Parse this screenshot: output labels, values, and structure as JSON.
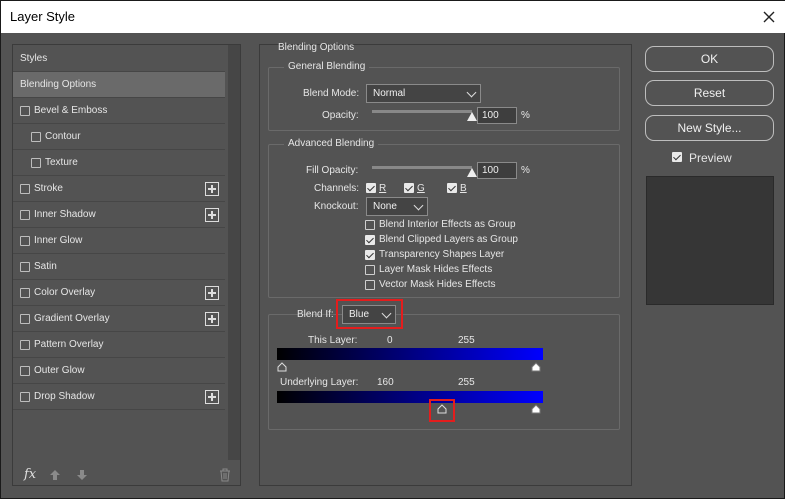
{
  "window": {
    "title": "Layer Style"
  },
  "left": {
    "items": [
      {
        "label": "Styles",
        "checkbox": false,
        "indent": 0,
        "plus": false,
        "selected": false
      },
      {
        "label": "Blending Options",
        "checkbox": false,
        "indent": 0,
        "plus": false,
        "selected": true
      },
      {
        "label": "Bevel & Emboss",
        "checkbox": true,
        "indent": 0,
        "plus": false,
        "selected": false
      },
      {
        "label": "Contour",
        "checkbox": true,
        "indent": 1,
        "plus": false,
        "selected": false
      },
      {
        "label": "Texture",
        "checkbox": true,
        "indent": 1,
        "plus": false,
        "selected": false
      },
      {
        "label": "Stroke",
        "checkbox": true,
        "indent": 0,
        "plus": true,
        "selected": false
      },
      {
        "label": "Inner Shadow",
        "checkbox": true,
        "indent": 0,
        "plus": true,
        "selected": false
      },
      {
        "label": "Inner Glow",
        "checkbox": true,
        "indent": 0,
        "plus": false,
        "selected": false
      },
      {
        "label": "Satin",
        "checkbox": true,
        "indent": 0,
        "plus": false,
        "selected": false
      },
      {
        "label": "Color Overlay",
        "checkbox": true,
        "indent": 0,
        "plus": true,
        "selected": false
      },
      {
        "label": "Gradient Overlay",
        "checkbox": true,
        "indent": 0,
        "plus": true,
        "selected": false
      },
      {
        "label": "Pattern Overlay",
        "checkbox": true,
        "indent": 0,
        "plus": false,
        "selected": false
      },
      {
        "label": "Outer Glow",
        "checkbox": true,
        "indent": 0,
        "plus": false,
        "selected": false
      },
      {
        "label": "Drop Shadow",
        "checkbox": true,
        "indent": 0,
        "plus": true,
        "selected": false
      }
    ],
    "fx_label": "fx"
  },
  "blending": {
    "section_title": "Blending Options",
    "general": {
      "title": "General Blending",
      "mode_label": "Blend Mode:",
      "mode_value": "Normal",
      "opacity_label": "Opacity:",
      "opacity_value": "100",
      "opacity_unit": "%",
      "opacity_level": 1.0
    },
    "advanced": {
      "title": "Advanced Blending",
      "fill_label": "Fill Opacity:",
      "fill_value": "100",
      "fill_unit": "%",
      "fill_level": 1.0,
      "channels_label": "Channels:",
      "channels": [
        {
          "label": "R",
          "checked": true
        },
        {
          "label": "G",
          "checked": true
        },
        {
          "label": "B",
          "checked": true
        }
      ],
      "knockout_label": "Knockout:",
      "knockout_value": "None",
      "options": [
        {
          "label": "Blend Interior Effects as Group",
          "checked": false
        },
        {
          "label": "Blend Clipped Layers as Group",
          "checked": true
        },
        {
          "label": "Transparency Shapes Layer",
          "checked": true
        },
        {
          "label": "Layer Mask Hides Effects",
          "checked": false
        },
        {
          "label": "Vector Mask Hides Effects",
          "checked": false
        }
      ]
    },
    "blendif": {
      "label": "Blend If:",
      "value": "Blue",
      "this_layer": {
        "label": "This Layer:",
        "low": "0",
        "high": "255"
      },
      "underlying": {
        "label": "Underlying Layer:",
        "low": "160",
        "high": "255"
      }
    }
  },
  "buttons": {
    "ok": "OK",
    "reset": "Reset",
    "new_style": "New Style...",
    "preview_label": "Preview",
    "preview_checked": true
  },
  "colors": {
    "dialog_bg": "#535353",
    "highlight": "#e41d1d",
    "blue": "#0000ff"
  }
}
